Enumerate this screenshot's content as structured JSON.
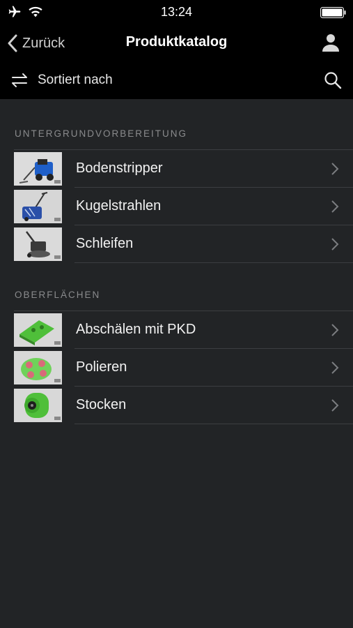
{
  "status": {
    "time": "13:24"
  },
  "nav": {
    "back_label": "Zurück",
    "title": "Produktkatalog"
  },
  "sort": {
    "label": "Sortiert nach"
  },
  "sections": [
    {
      "header": "UNTERGRUNDVORBEREITUNG",
      "items": [
        {
          "label": "Bodenstripper"
        },
        {
          "label": "Kugelstrahlen"
        },
        {
          "label": "Schleifen"
        }
      ]
    },
    {
      "header": "OBERFLÄCHEN",
      "items": [
        {
          "label": "Abschälen mit PKD"
        },
        {
          "label": "Polieren"
        },
        {
          "label": "Stocken"
        }
      ]
    }
  ],
  "colors": {
    "background": "#222426",
    "bar": "#000000",
    "accent_green": "#4fbf3a",
    "machine_blue": "#2a57b8"
  },
  "icons": [
    "airplane-icon",
    "wifi-icon",
    "battery-icon",
    "chevron-left-icon",
    "user-icon",
    "swap-arrows-icon",
    "search-icon",
    "chevron-right-icon"
  ]
}
